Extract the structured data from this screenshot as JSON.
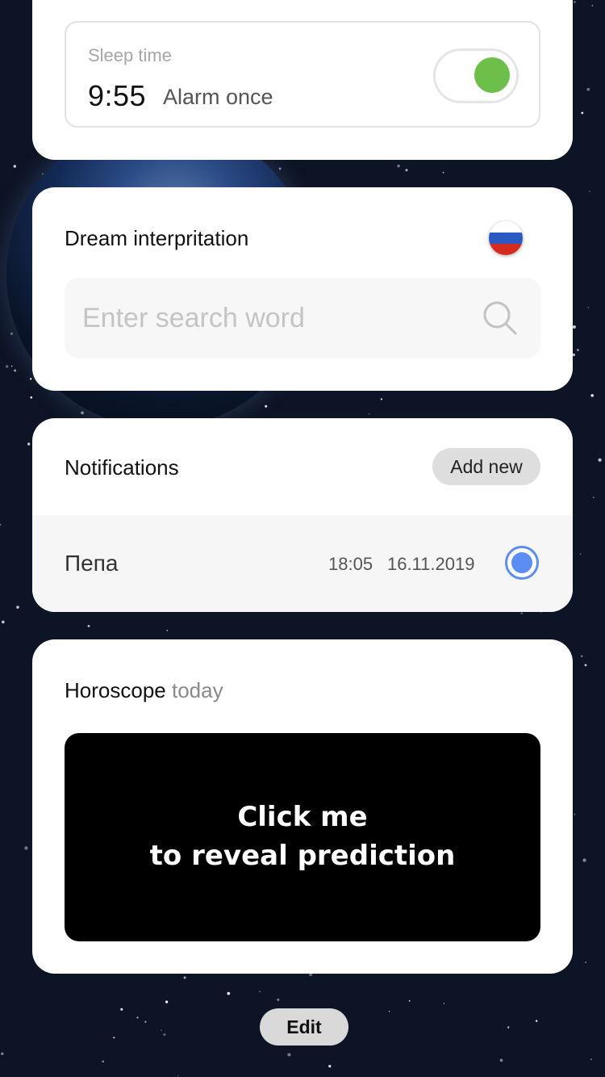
{
  "colors": {
    "background": "#0d1425",
    "toggle_on": "#6cc04a",
    "radio_accent": "#5b8df4"
  },
  "sleep": {
    "label": "Sleep time",
    "time": "9:55",
    "repeat": "Alarm once",
    "enabled": true
  },
  "dream": {
    "title": "Dream interpritation",
    "language_flag": "russia-flag-icon",
    "search_placeholder": "Enter search word",
    "search_value": ""
  },
  "notifications": {
    "title": "Notifications",
    "add_label": "Add new",
    "items": [
      {
        "name": "Пепа",
        "time": "18:05",
        "date": "16.11.2019",
        "selected": true
      }
    ]
  },
  "horoscope": {
    "title_bold": "Horoscope",
    "title_light": "today",
    "reveal_line1": "Click me",
    "reveal_line2": "to reveal prediction"
  },
  "footer": {
    "edit_label": "Edit"
  }
}
